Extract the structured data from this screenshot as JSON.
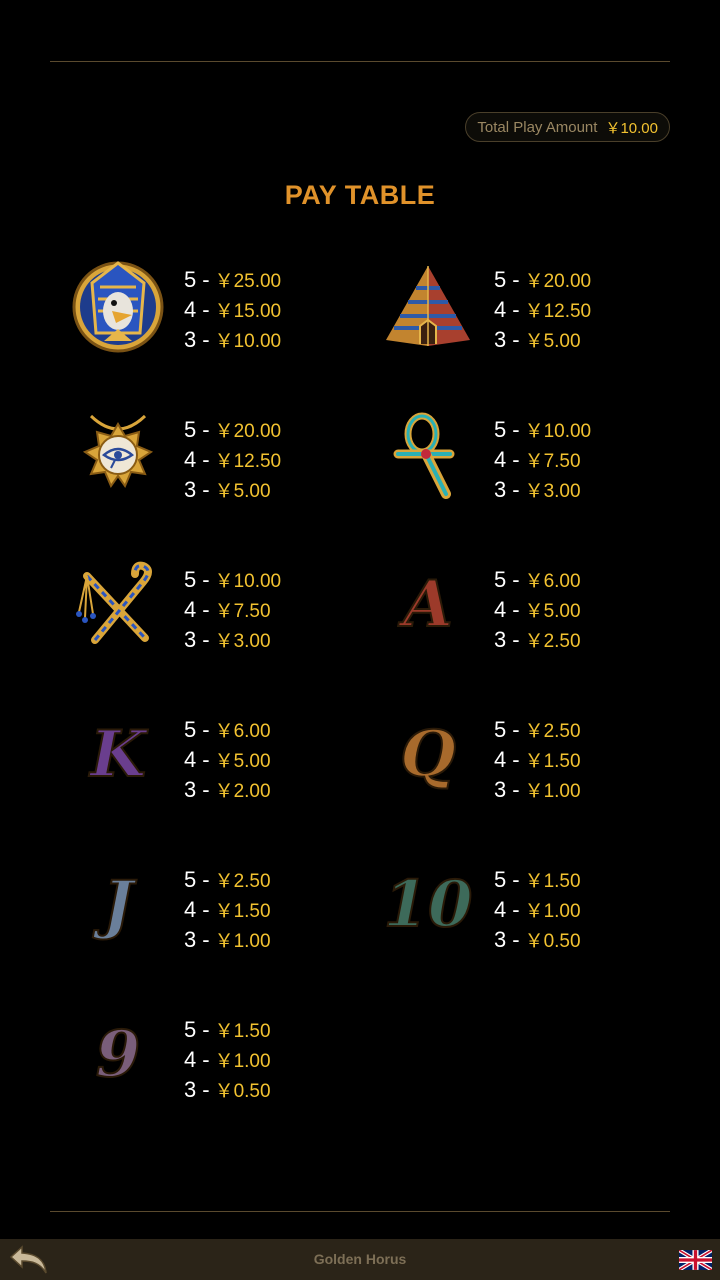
{
  "header": {
    "total_label": "Total Play Amount",
    "total_value": "￥10.00"
  },
  "title": "PAY TABLE",
  "symbols": [
    {
      "icon": "horus-icon",
      "pays": [
        {
          "count": "5",
          "amount": "￥25.00"
        },
        {
          "count": "4",
          "amount": "￥15.00"
        },
        {
          "count": "3",
          "amount": "￥10.00"
        }
      ]
    },
    {
      "icon": "pyramid-icon",
      "pays": [
        {
          "count": "5",
          "amount": "￥20.00"
        },
        {
          "count": "4",
          "amount": "￥12.50"
        },
        {
          "count": "3",
          "amount": "￥5.00"
        }
      ]
    },
    {
      "icon": "eye-amulet-icon",
      "pays": [
        {
          "count": "5",
          "amount": "￥20.00"
        },
        {
          "count": "4",
          "amount": "￥12.50"
        },
        {
          "count": "3",
          "amount": "￥5.00"
        }
      ]
    },
    {
      "icon": "ankh-icon",
      "pays": [
        {
          "count": "5",
          "amount": "￥10.00"
        },
        {
          "count": "4",
          "amount": "￥7.50"
        },
        {
          "count": "3",
          "amount": "￥3.00"
        }
      ]
    },
    {
      "icon": "crook-flail-icon",
      "pays": [
        {
          "count": "5",
          "amount": "￥10.00"
        },
        {
          "count": "4",
          "amount": "￥7.50"
        },
        {
          "count": "3",
          "amount": "￥3.00"
        }
      ]
    },
    {
      "icon": "letter-a-icon",
      "glyph": "A",
      "color": "#9c3a2a",
      "pays": [
        {
          "count": "5",
          "amount": "￥6.00"
        },
        {
          "count": "4",
          "amount": "￥5.00"
        },
        {
          "count": "3",
          "amount": "￥2.50"
        }
      ]
    },
    {
      "icon": "letter-k-icon",
      "glyph": "K",
      "color": "#6a3e8e",
      "pays": [
        {
          "count": "5",
          "amount": "￥6.00"
        },
        {
          "count": "4",
          "amount": "￥5.00"
        },
        {
          "count": "3",
          "amount": "￥2.00"
        }
      ]
    },
    {
      "icon": "letter-q-icon",
      "glyph": "Q",
      "color": "#a86a2c",
      "pays": [
        {
          "count": "5",
          "amount": "￥2.50"
        },
        {
          "count": "4",
          "amount": "￥1.50"
        },
        {
          "count": "3",
          "amount": "￥1.00"
        }
      ]
    },
    {
      "icon": "letter-j-icon",
      "glyph": "J",
      "color": "#6a7f9a",
      "pays": [
        {
          "count": "5",
          "amount": "￥2.50"
        },
        {
          "count": "4",
          "amount": "￥1.50"
        },
        {
          "count": "3",
          "amount": "￥1.00"
        }
      ]
    },
    {
      "icon": "number-10-icon",
      "glyph": "10",
      "color": "#3d6a5a",
      "pays": [
        {
          "count": "5",
          "amount": "￥1.50"
        },
        {
          "count": "4",
          "amount": "￥1.00"
        },
        {
          "count": "3",
          "amount": "￥0.50"
        }
      ]
    },
    {
      "icon": "number-9-icon",
      "glyph": "9",
      "color": "#7a5e7a",
      "pays": [
        {
          "count": "5",
          "amount": "￥1.50"
        },
        {
          "count": "4",
          "amount": "￥1.00"
        },
        {
          "count": "3",
          "amount": "￥0.50"
        }
      ]
    }
  ],
  "footer": {
    "game_name": "Golden Horus",
    "back_icon": "back-arrow-icon",
    "language_icon": "uk-flag-icon"
  },
  "colors": {
    "accent_gold": "#f2c230",
    "title_orange": "#e0922a",
    "footer_bg": "#2b2418"
  }
}
